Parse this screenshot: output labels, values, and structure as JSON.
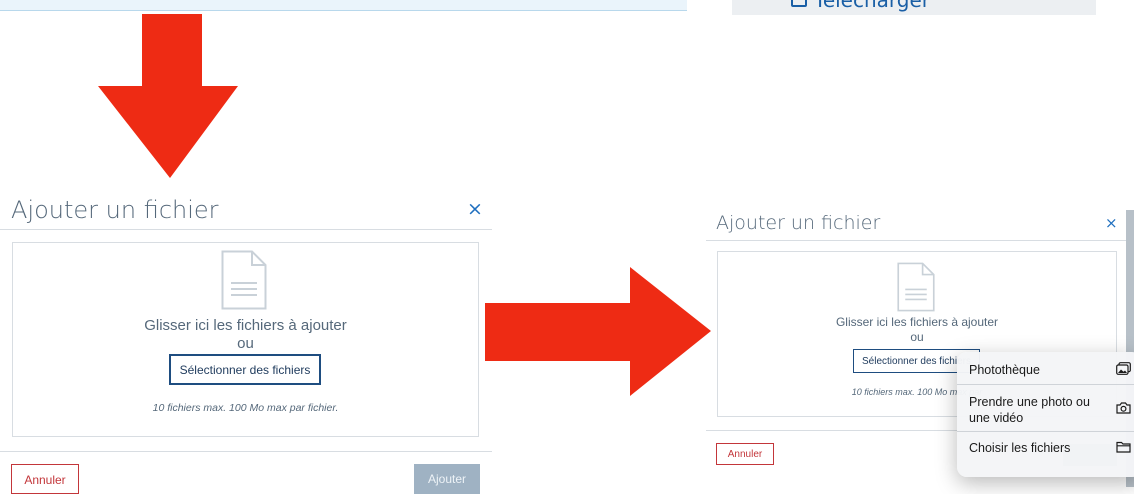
{
  "background_top": {
    "download_button": {
      "label": "Télécharger",
      "icon": "download-icon"
    }
  },
  "arrows": {
    "color": "#ee2b14"
  },
  "modal_a": {
    "title": "Ajouter un fichier",
    "close_symbol": "×",
    "drop_zone": {
      "file_icon": "document-icon",
      "drag_text": "Glisser ici les fichiers à ajouter",
      "or_text": "ou",
      "select_label": "Sélectionner des fichiers",
      "limit_text": "10 fichiers max. 100 Mo max par fichier."
    },
    "cancel_label": "Annuler",
    "add_label": "Ajouter"
  },
  "modal_b": {
    "title": "Ajouter un fichier",
    "close_symbol": "×",
    "drop_zone": {
      "file_icon": "document-icon",
      "drag_text": "Glisser ici les fichiers à ajouter",
      "or_text": "ou",
      "select_label": "Sélectionner des fichiers",
      "limit_text": "10 fichiers max. 100 Mo max par"
    },
    "cancel_label": "Annuler"
  },
  "ios_menu": {
    "items": [
      {
        "label": "Photothèque",
        "icon": "photo-library-icon"
      },
      {
        "label": "Prendre une photo ou une vidéo",
        "icon": "camera-icon"
      },
      {
        "label": "Choisir les fichiers",
        "icon": "folder-icon"
      }
    ]
  },
  "colors": {
    "accent_blue": "#1f6fbf",
    "cancel_red": "#c3363a",
    "disabled_button": "#9fb2c3"
  }
}
